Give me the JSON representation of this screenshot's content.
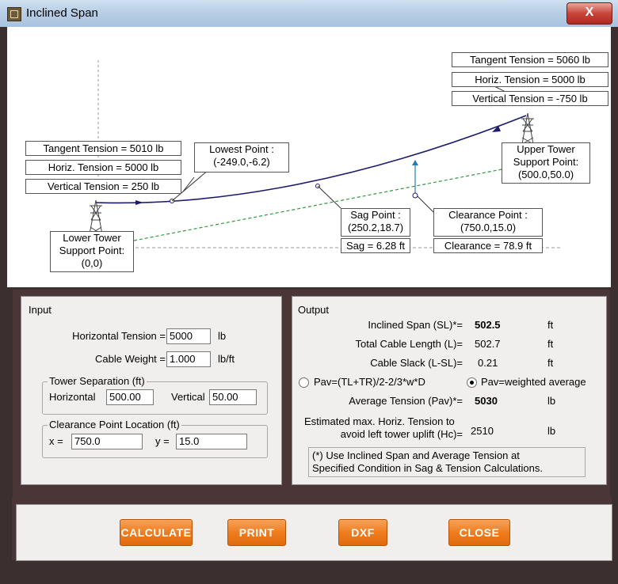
{
  "window": {
    "title": "Inclined Span",
    "close_label": "X"
  },
  "diagram": {
    "right_tension": {
      "tangent": "Tangent Tension = 5060 lb",
      "horiz": "Horiz. Tension = 5000 lb",
      "vertical": "Vertical Tension = -750 lb"
    },
    "left_tension": {
      "tangent": "Tangent Tension = 5010 lb",
      "horiz": "Horiz. Tension = 5000 lb",
      "vertical": "Vertical Tension = 250 lb"
    },
    "lowest_point": {
      "title": "Lowest Point :",
      "value": "(-249.0,-6.2)"
    },
    "upper_tower": {
      "line1": "Upper Tower",
      "line2": "Support Point:",
      "value": "(500.0,50.0)"
    },
    "lower_tower": {
      "line1": "Lower Tower",
      "line2": "Support Point:",
      "value": "(0,0)"
    },
    "sag_point": {
      "title": "Sag Point :",
      "value": "(250.2,18.7)",
      "sag": "Sag = 6.28 ft"
    },
    "clearance_point": {
      "title": "Clearance Point :",
      "value": "(750.0,15.0)",
      "clearance": "Clearance = 78.9 ft"
    }
  },
  "input": {
    "title": "Input",
    "horizontal_tension_label": "Horizontal Tension =",
    "horizontal_tension_value": "5000",
    "horizontal_tension_unit": "lb",
    "cable_weight_label": "Cable Weight =",
    "cable_weight_value": "1.000",
    "cable_weight_unit": "lb/ft",
    "tower_sep_title": "Tower Separation (ft)",
    "horizontal_label": "Horizontal",
    "horizontal_value": "500.00",
    "vertical_label": "Vertical",
    "vertical_value": "50.00",
    "clearance_title": "Clearance Point Location (ft)",
    "x_label": "x =",
    "x_value": "750.0",
    "y_label": "y =",
    "y_value": "15.0"
  },
  "output": {
    "title": "Output",
    "inclined_span_label": "Inclined Span (SL)*=",
    "inclined_span_value": "502.5",
    "inclined_span_unit": "ft",
    "cable_length_label": "Total Cable Length (L)=",
    "cable_length_value": "502.7",
    "cable_length_unit": "ft",
    "cable_slack_label": "Cable Slack (L-SL)=",
    "cable_slack_value": "0.21",
    "cable_slack_unit": "ft",
    "radio1_label": "Pav=(TL+TR)/2-2/3*w*D",
    "radio2_label": "Pav=weighted average",
    "avg_tension_label": "Average Tension (Pav)*=",
    "avg_tension_value": "5030",
    "avg_tension_unit": "lb",
    "hc_label_1": "Estimated max. Horiz. Tension to",
    "hc_label_2": "avoid left tower uplift (Hc)=",
    "hc_value": "2510",
    "hc_unit": "lb",
    "note_1": "(*) Use Inclined Span and Average Tension at",
    "note_2": "Specified Condition in Sag & Tension Calculations."
  },
  "buttons": {
    "calculate": "CALCULATE",
    "print": "PRINT",
    "dxf": "DXF",
    "close": "CLOSE"
  }
}
